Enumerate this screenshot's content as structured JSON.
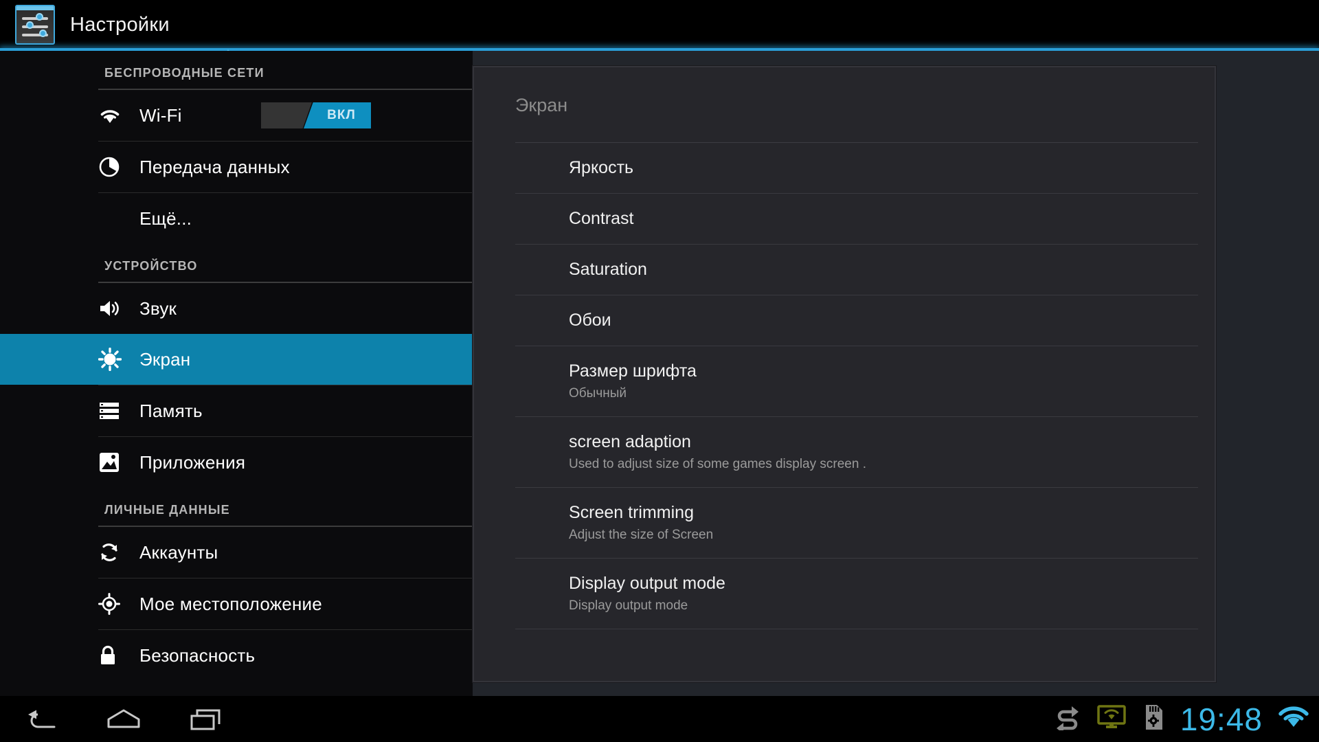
{
  "titlebar": {
    "title": "Настройки",
    "icon": "settings-sliders-icon",
    "accent": "#2a9fd8"
  },
  "sidebar": {
    "sections": [
      {
        "header": "БЕСПРОВОДНЫЕ СЕТИ",
        "items": [
          {
            "label": "Wi-Fi",
            "icon": "wifi-icon",
            "selected": false,
            "toggle": {
              "state": "ВКЛ",
              "on": true
            }
          },
          {
            "label": "Передача данных",
            "icon": "data-usage-icon",
            "selected": false
          },
          {
            "label": "Ещё...",
            "icon": "none",
            "selected": false
          }
        ]
      },
      {
        "header": "УСТРОЙСТВО",
        "items": [
          {
            "label": "Звук",
            "icon": "volume-icon",
            "selected": false
          },
          {
            "label": "Экран",
            "icon": "brightness-icon",
            "selected": true
          },
          {
            "label": "Память",
            "icon": "storage-icon",
            "selected": false
          },
          {
            "label": "Приложения",
            "icon": "apps-icon",
            "selected": false
          }
        ]
      },
      {
        "header": "ЛИЧНЫЕ ДАННЫЕ",
        "items": [
          {
            "label": "Аккаунты",
            "icon": "sync-icon",
            "selected": false
          },
          {
            "label": "Мое местоположение",
            "icon": "location-icon",
            "selected": false
          },
          {
            "label": "Безопасность",
            "icon": "lock-icon",
            "selected": false
          }
        ]
      }
    ],
    "highlight_color": "#0d82ab"
  },
  "panel": {
    "title": "Экран",
    "items": [
      {
        "title": "Яркость",
        "subtitle": ""
      },
      {
        "title": "Contrast",
        "subtitle": ""
      },
      {
        "title": "Saturation",
        "subtitle": ""
      },
      {
        "title": "Обои",
        "subtitle": ""
      },
      {
        "title": "Размер шрифта",
        "subtitle": "Обычный"
      },
      {
        "title": "screen adaption",
        "subtitle": "Used to adjust size of some games display screen ."
      },
      {
        "title": "Screen trimming",
        "subtitle": "Adjust the size of Screen"
      },
      {
        "title": "Display output mode",
        "subtitle": "Display output mode"
      }
    ]
  },
  "navbar": {
    "buttons": [
      {
        "name": "back-icon",
        "label": "Назад"
      },
      {
        "name": "home-icon",
        "label": "Главный экран"
      },
      {
        "name": "recents-icon",
        "label": "Недавние приложения"
      }
    ],
    "status": {
      "icons": [
        {
          "name": "sync-status-icon",
          "color": "#8a8a8a"
        },
        {
          "name": "wireless-display-icon",
          "color": "#6f7512"
        },
        {
          "name": "sd-card-settings-icon",
          "color": "#8a8a8a"
        }
      ],
      "clock": "19:48",
      "wifi": {
        "name": "wifi-status-icon",
        "color": "#3cb9e8"
      }
    }
  }
}
